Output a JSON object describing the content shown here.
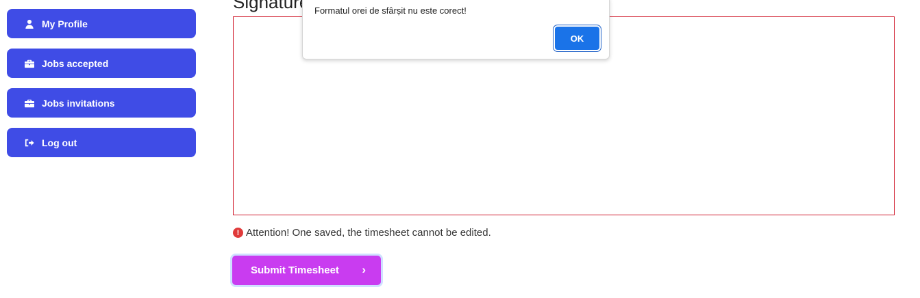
{
  "sidebar": {
    "items": [
      {
        "label": "My Profile",
        "icon": "user-icon"
      },
      {
        "label": "Jobs accepted",
        "icon": "briefcase-icon"
      },
      {
        "label": "Jobs invitations",
        "icon": "briefcase-icon"
      },
      {
        "label": "Log out",
        "icon": "logout-icon"
      }
    ],
    "color": "#3f4ce6"
  },
  "main": {
    "signature_title": "Signature",
    "attention_text": "Attention! One saved, the timesheet cannot be edited.",
    "submit_label": "Submit Timesheet",
    "submit_color": "#c93cf0",
    "signature_border_color": "#d0192b"
  },
  "dialog": {
    "message": "Formatul orei de sfârșit nu este corect!",
    "ok_label": "OK"
  }
}
